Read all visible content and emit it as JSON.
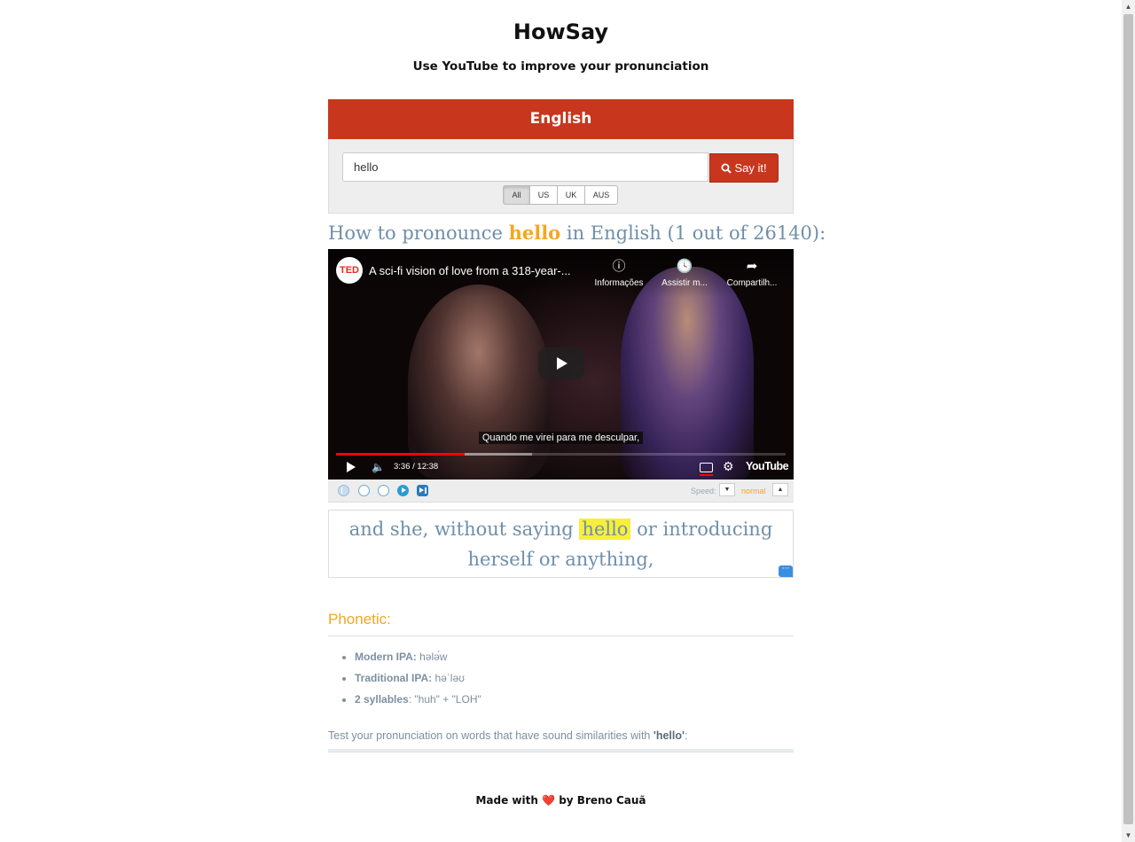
{
  "app": {
    "title": "HowSay",
    "subtitle": "Use YouTube to improve your pronunciation"
  },
  "language_bar": {
    "label": "English"
  },
  "search": {
    "value": "hello",
    "button_label": "Say it!",
    "accents": [
      {
        "label": "All",
        "active": true
      },
      {
        "label": "US",
        "active": false
      },
      {
        "label": "UK",
        "active": false
      },
      {
        "label": "AUS",
        "active": false
      }
    ]
  },
  "result_heading": {
    "prefix": "How to pronounce",
    "word": "hello",
    "suffix": "in English (1 out of 26140):"
  },
  "video": {
    "channel_logo": "TED",
    "title": "A sci-fi vision of love from a 318-year-...",
    "actions": [
      {
        "icon": "info-icon",
        "label": "Informações"
      },
      {
        "icon": "clock-icon",
        "label": "Assistir m..."
      },
      {
        "icon": "share-icon",
        "label": "Compartilh..."
      }
    ],
    "caption": "Quando me virei para me desculpar,",
    "time": "3:36 / 12:38",
    "played_fraction": 0.286,
    "buffered_fraction": 0.436,
    "brand": "YouTube"
  },
  "player_controls": {
    "speed_label": "Speed:",
    "speed_value": "normal",
    "speed_dec": "▼",
    "speed_inc": "▲"
  },
  "sentence": {
    "before": "and she, without saying",
    "highlight": "hello",
    "after": "or introducing herself or anything,"
  },
  "phonetic": {
    "title": "Phonetic:",
    "items": [
      {
        "key": "Modern IPA:",
        "value": " həlә́w"
      },
      {
        "key": "Traditional IPA:",
        "value": " həˈləʊ"
      },
      {
        "key": "2 syllables",
        "value": ": \"huh\" + \"LOH\""
      }
    ]
  },
  "similar": {
    "text": "Test your pronunciation on words that have sound similarities with",
    "word": "'hello'",
    "end": ":"
  },
  "footer": {
    "before": "Made with",
    "heart": "❤️",
    "after": "by Breno Cauã"
  },
  "colors": {
    "brand_red": "#c8361e",
    "accent_orange": "#f5a623",
    "text_blue": "#6e8faa",
    "highlight_yellow": "#f7ef3a"
  }
}
